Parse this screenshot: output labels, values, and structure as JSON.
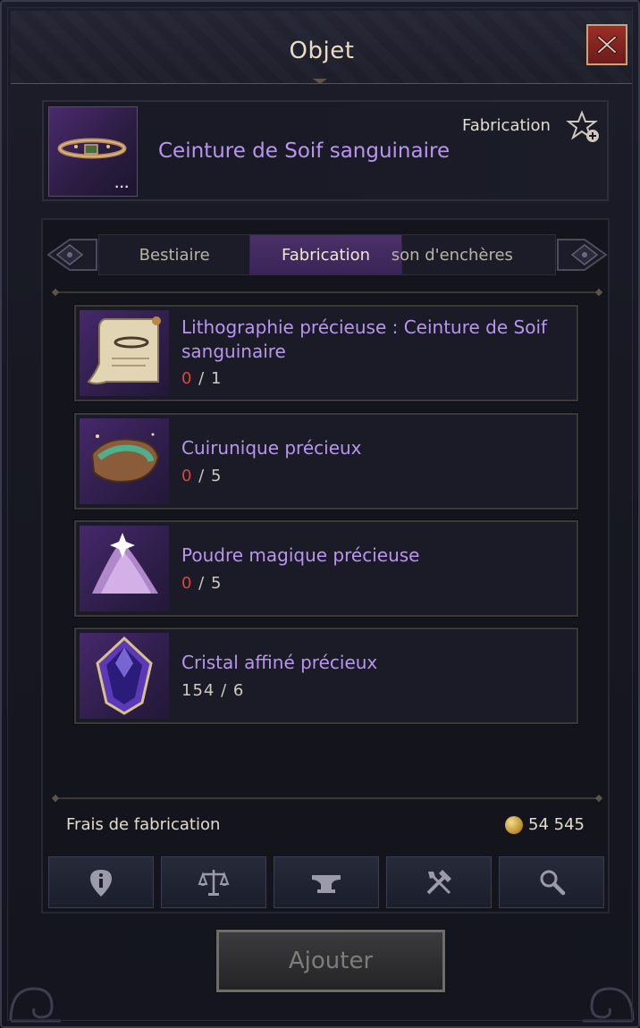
{
  "window": {
    "title": "Objet",
    "close_label": "X"
  },
  "item": {
    "name": "Ceinture de Soif sanguinaire",
    "type": "Fabrication",
    "more_label": "..."
  },
  "tabs": [
    {
      "label": "Bestiaire"
    },
    {
      "label": "Fabrication",
      "active": true
    },
    {
      "label": "son d'enchères"
    }
  ],
  "materials": [
    {
      "name": "Lithographie précieuse : Ceinture de Soif sanguinaire",
      "have": "0",
      "need": "1"
    },
    {
      "name": "Cuirunique précieux",
      "have": "0",
      "need": "5"
    },
    {
      "name": "Poudre magique précieuse",
      "have": "0",
      "need": "5"
    },
    {
      "name": "Cristal affiné précieux",
      "have": "154",
      "need": "6"
    }
  ],
  "cost": {
    "label": "Frais de fabrication",
    "value": "54 545"
  },
  "icon_buttons": [
    "info-icon",
    "scales-icon",
    "anvil-icon",
    "tools-icon",
    "search-icon"
  ],
  "add_button": {
    "label": "Ajouter"
  },
  "colors": {
    "accent_purple": "#b994f0",
    "zero_red": "#e0443c",
    "title_gold": "#eadcc0"
  }
}
